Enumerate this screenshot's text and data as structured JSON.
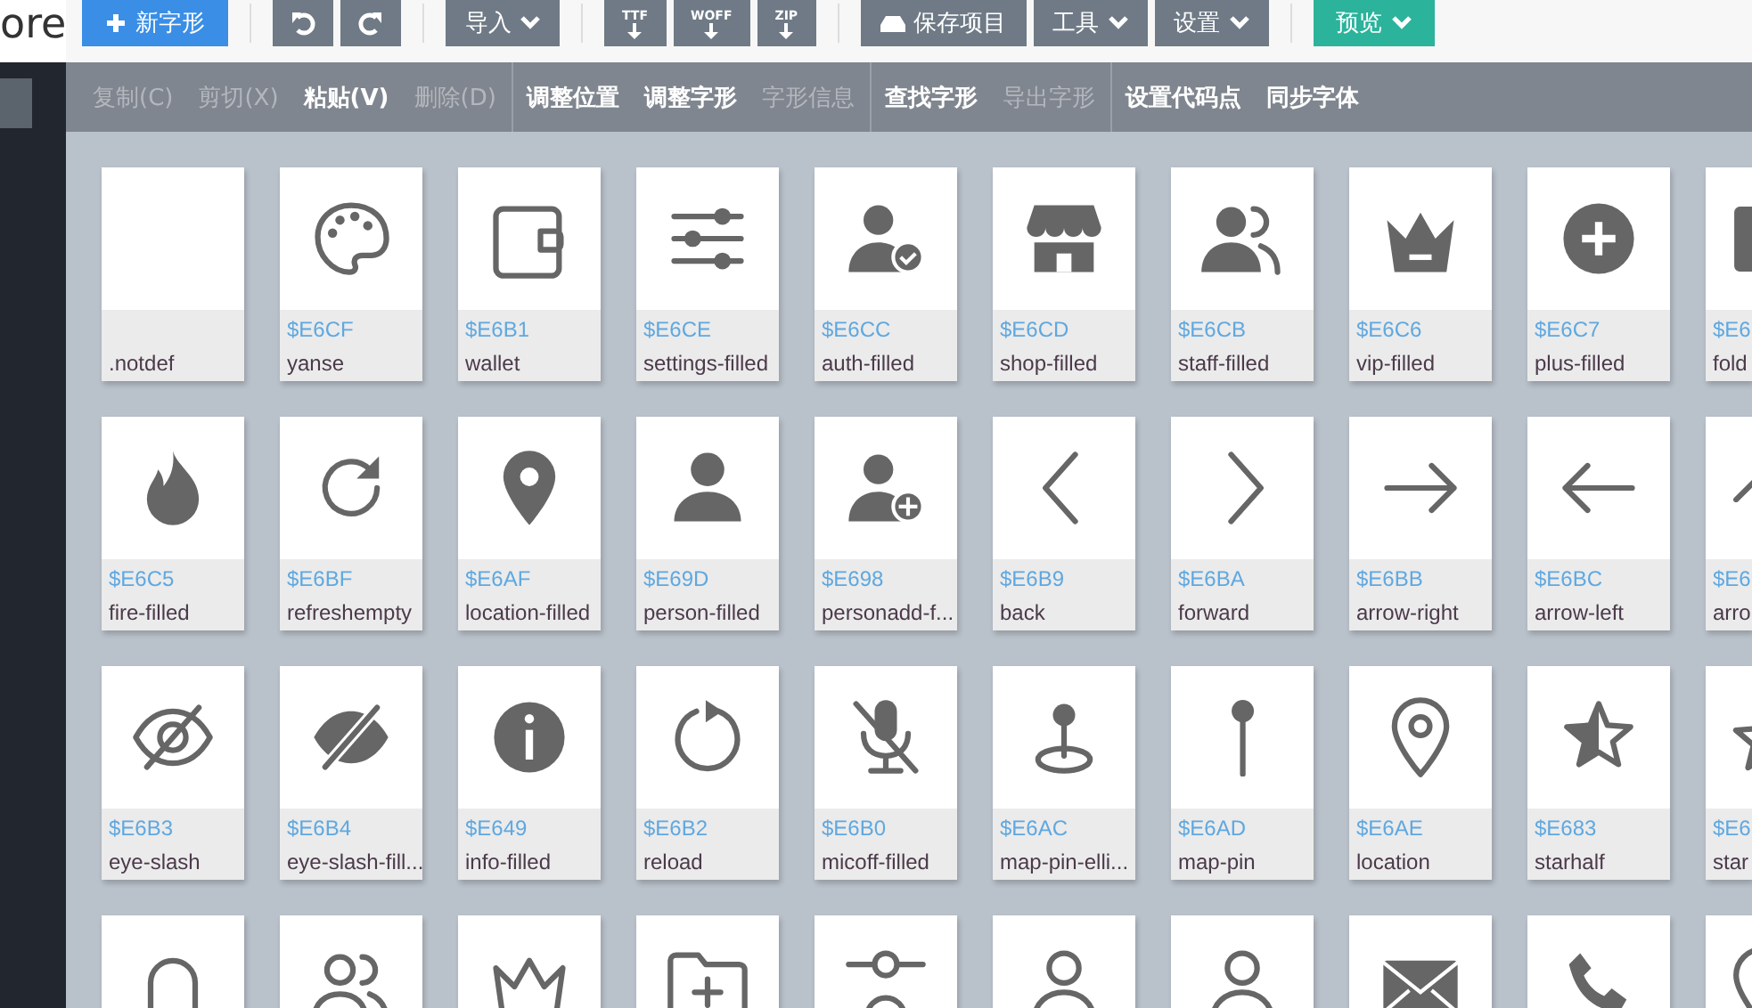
{
  "app_title": "ore",
  "toolbar": {
    "groups": [
      [
        {
          "kind": "new",
          "color": "#3a8ee6",
          "label": "新字形"
        }
      ],
      [
        {
          "kind": "undo",
          "color": "#6f7a86"
        },
        {
          "kind": "redo",
          "color": "#6f7a86"
        }
      ],
      [
        {
          "kind": "menu",
          "color": "#6f7a86",
          "label": "导入"
        }
      ],
      [
        {
          "kind": "export",
          "color": "#6f7a86",
          "label": "TTF"
        },
        {
          "kind": "export",
          "color": "#6f7a86",
          "label": "WOFF"
        },
        {
          "kind": "export",
          "color": "#6f7a86",
          "label": "ZIP"
        }
      ],
      [
        {
          "kind": "save",
          "color": "#6f7a86",
          "label": "保存项目"
        },
        {
          "kind": "menu",
          "color": "#6f7a86",
          "label": "工具"
        },
        {
          "kind": "menu",
          "color": "#6f7a86",
          "label": "设置"
        }
      ],
      [
        {
          "kind": "menu",
          "color": "#2bb39b",
          "label": "预览"
        }
      ]
    ]
  },
  "edit_bar": {
    "groups": [
      [
        {
          "label": "复制(C)",
          "disabled": true
        },
        {
          "label": "剪切(X)",
          "disabled": true
        },
        {
          "label": "粘贴(V)",
          "disabled": false
        },
        {
          "label": "删除(D)",
          "disabled": true
        }
      ],
      [
        {
          "label": "调整位置",
          "disabled": false
        },
        {
          "label": "调整字形",
          "disabled": false
        },
        {
          "label": "字形信息",
          "disabled": true
        }
      ],
      [
        {
          "label": "查找字形",
          "disabled": false
        },
        {
          "label": "导出字形",
          "disabled": true
        }
      ],
      [
        {
          "label": "设置代码点",
          "disabled": false
        },
        {
          "label": "同步字体",
          "disabled": false
        }
      ]
    ]
  },
  "glyph_rows": [
    [
      {
        "name": ".notdef"
      },
      {
        "code": "$E6CF",
        "name": "yanse"
      },
      {
        "code": "$E6B1",
        "name": "wallet"
      },
      {
        "code": "$E6CE",
        "name": "settings-filled"
      },
      {
        "code": "$E6CC",
        "name": "auth-filled"
      },
      {
        "code": "$E6CD",
        "name": "shop-filled"
      },
      {
        "code": "$E6CB",
        "name": "staff-filled"
      },
      {
        "code": "$E6C6",
        "name": "vip-filled"
      },
      {
        "code": "$E6C7",
        "name": "plus-filled"
      },
      {
        "code": "$E6",
        "name": "fold"
      }
    ],
    [
      {
        "code": "$E6C5",
        "name": "fire-filled"
      },
      {
        "code": "$E6BF",
        "name": "refreshempty"
      },
      {
        "code": "$E6AF",
        "name": "location-filled"
      },
      {
        "code": "$E69D",
        "name": "person-filled"
      },
      {
        "code": "$E698",
        "name": "personadd-f..."
      },
      {
        "code": "$E6B9",
        "name": "back"
      },
      {
        "code": "$E6BA",
        "name": "forward"
      },
      {
        "code": "$E6BB",
        "name": "arrow-right"
      },
      {
        "code": "$E6BC",
        "name": "arrow-left"
      },
      {
        "code": "$E6",
        "name": "arro"
      }
    ],
    [
      {
        "code": "$E6B3",
        "name": "eye-slash"
      },
      {
        "code": "$E6B4",
        "name": "eye-slash-fill..."
      },
      {
        "code": "$E649",
        "name": "info-filled"
      },
      {
        "code": "$E6B2",
        "name": "reload"
      },
      {
        "code": "$E6B0",
        "name": "micoff-filled"
      },
      {
        "code": "$E6AC",
        "name": "map-pin-elli..."
      },
      {
        "code": "$E6AD",
        "name": "map-pin"
      },
      {
        "code": "$E6AE",
        "name": "location"
      },
      {
        "code": "$E683",
        "name": "starhalf"
      },
      {
        "code": "$E6",
        "name": "star"
      }
    ],
    [
      {},
      {},
      {},
      {},
      {},
      {},
      {},
      {},
      {},
      {}
    ]
  ]
}
